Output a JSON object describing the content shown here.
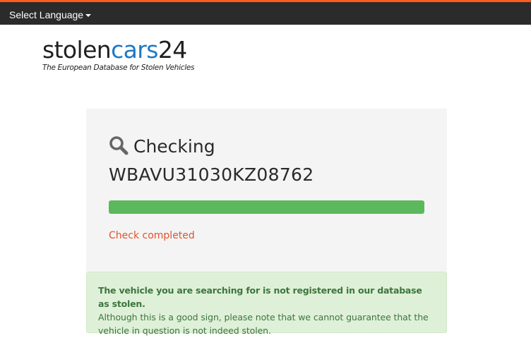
{
  "topbar": {
    "language_label": "Select Language",
    "accent_color": "#ff5a1f",
    "caret_icon": "caret-down-icon"
  },
  "logo": {
    "word_part1": "stolen",
    "word_part2": "cars",
    "word_part3": "24",
    "tagline": "The European Database for Stolen Vehicles",
    "brand_color": "#1b78c6"
  },
  "check": {
    "icon": "search-icon",
    "title": "Checking",
    "vin": "WBAVU31030KZ08762",
    "progress_percent": 100,
    "progress_color": "#5cb85c",
    "status": "Check completed"
  },
  "result": {
    "strong": "The vehicle you are searching for is not registered in our database as stolen.",
    "body": "Although this is a good sign, please note that we cannot guarantee that the vehicle in question is not indeed stolen."
  }
}
